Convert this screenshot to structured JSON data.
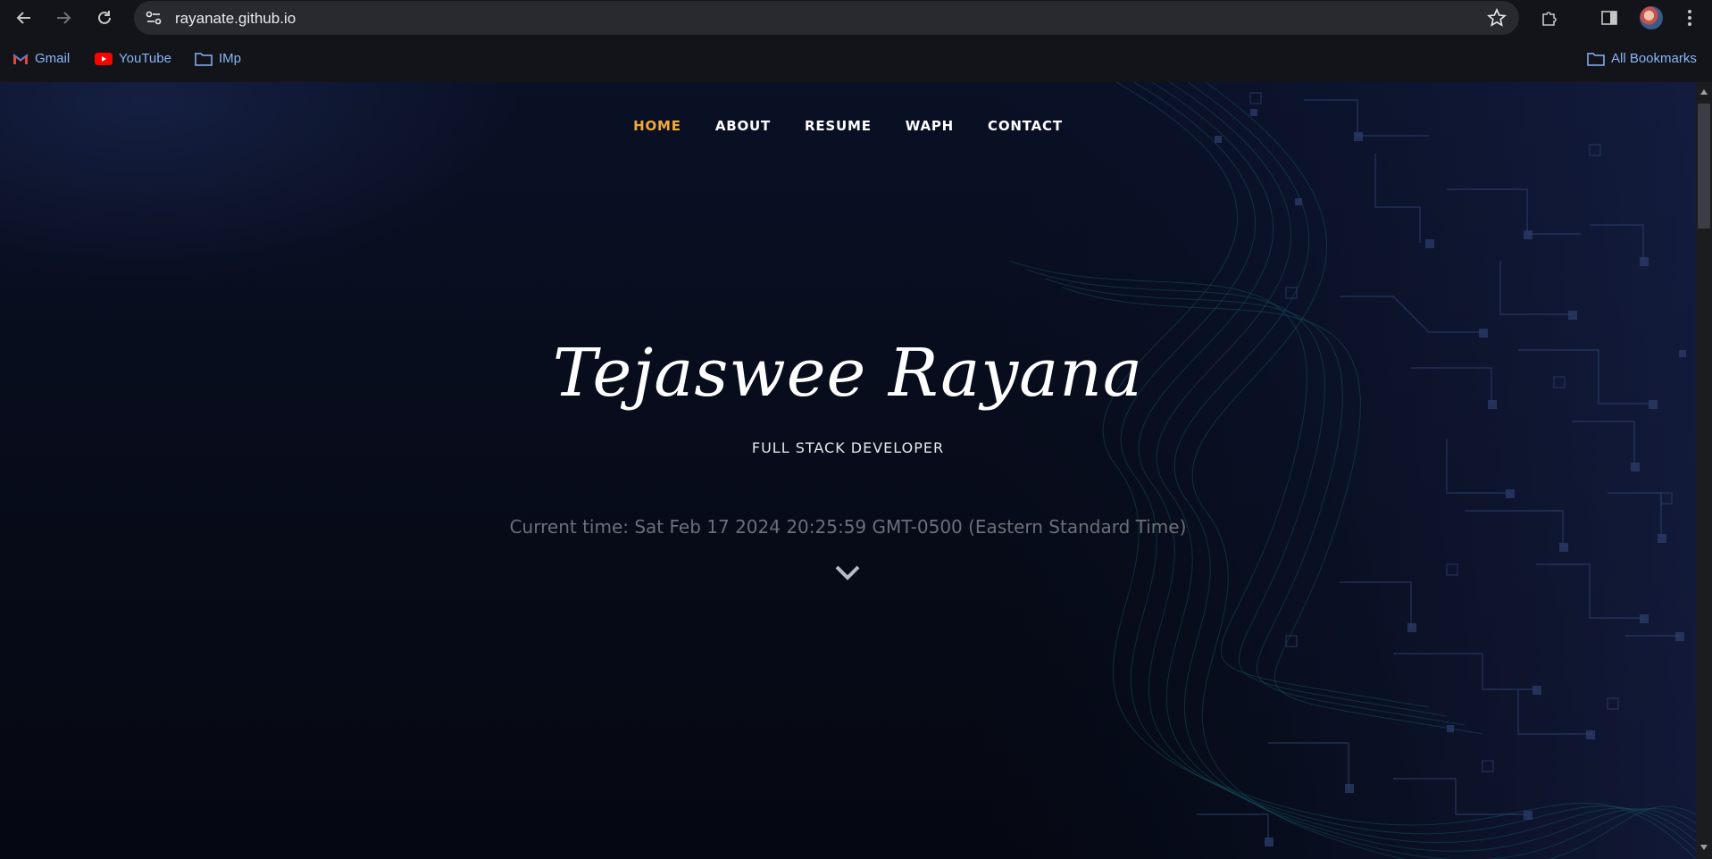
{
  "browser": {
    "url": "rayanate.github.io",
    "bookmarks": [
      {
        "label": "Gmail",
        "icon": "gmail-icon"
      },
      {
        "label": "YouTube",
        "icon": "youtube-icon"
      },
      {
        "label": "IMp",
        "icon": "folder-icon"
      }
    ],
    "all_bookmarks_label": "All Bookmarks"
  },
  "site": {
    "nav": [
      {
        "label": "HOME",
        "active": true
      },
      {
        "label": "ABOUT"
      },
      {
        "label": "RESUME"
      },
      {
        "label": "WAPH"
      },
      {
        "label": "CONTACT"
      }
    ],
    "hero": {
      "name": "Tejaswee Rayana",
      "subtitle": "FULL STACK DEVELOPER",
      "clock": "Current time: Sat Feb 17 2024 20:25:59 GMT-0500 (Eastern Standard Time)"
    },
    "colors": {
      "accent": "#f2a93b",
      "background": "#0b0f1a"
    }
  }
}
